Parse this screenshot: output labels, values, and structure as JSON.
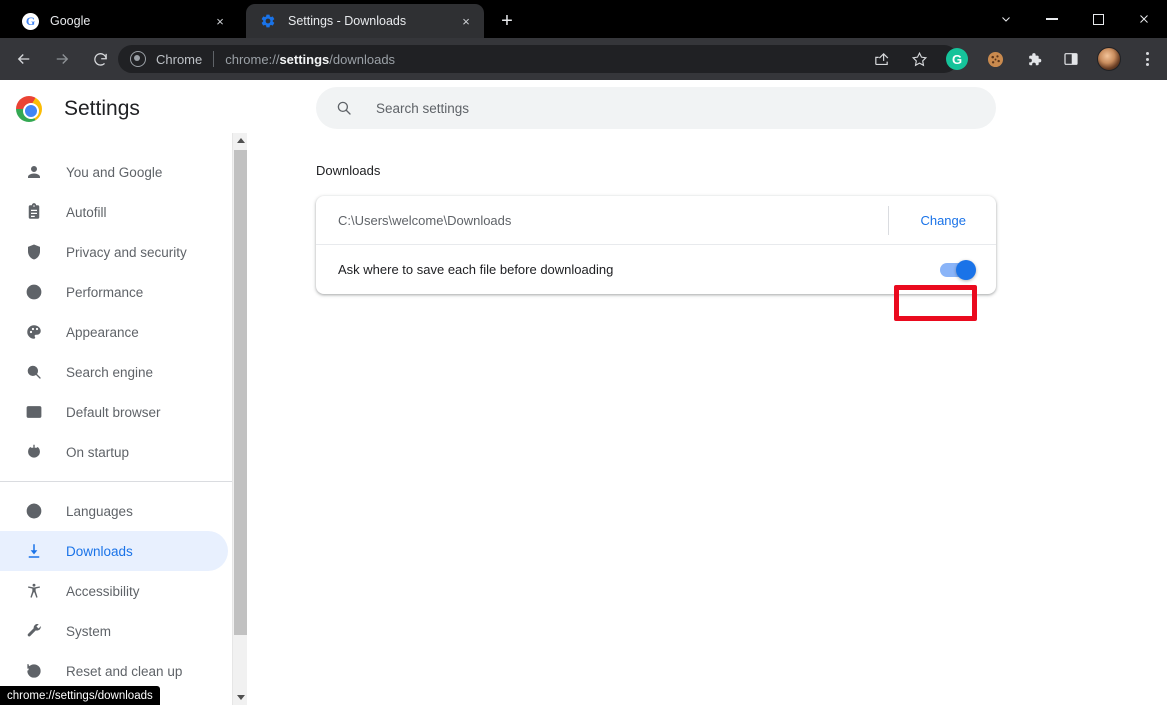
{
  "window": {
    "controls": [
      {
        "name": "tab-search",
        "glyph": "chevron-down"
      },
      {
        "name": "minimize",
        "glyph": "dash"
      },
      {
        "name": "maximize",
        "glyph": "square"
      },
      {
        "name": "close",
        "glyph": "×"
      }
    ]
  },
  "tabs": [
    {
      "title": "Google",
      "favicon": "google-g-icon",
      "active": false,
      "close_label": "×"
    },
    {
      "title": "Settings - Downloads",
      "favicon": "gear-icon",
      "active": true,
      "close_label": "×"
    }
  ],
  "newtab_label": "+",
  "toolbar": {
    "back_label": "←",
    "forward_label": "→",
    "reload_label": "⟳",
    "omnibox": {
      "site_label": "Chrome",
      "url_prefix": "chrome://",
      "url_bold": "settings",
      "url_suffix": "/downloads",
      "full_url": "chrome://settings/downloads"
    },
    "right_icons": [
      {
        "name": "share-icon"
      },
      {
        "name": "bookmark-star-icon"
      },
      {
        "name": "grammarly-extension-icon",
        "letter": "G",
        "color": "#15c39a"
      },
      {
        "name": "cookie-extension-icon",
        "color": "#b3733a"
      },
      {
        "name": "extensions-puzzle-icon"
      },
      {
        "name": "side-panel-icon"
      },
      {
        "name": "profile-avatar"
      },
      {
        "name": "chrome-menu-icon"
      }
    ]
  },
  "sidebar": {
    "title": "Settings",
    "logo": "chrome-logo-icon",
    "items": [
      {
        "label": "You and Google",
        "icon": "person-icon",
        "selected": false
      },
      {
        "label": "Autofill",
        "icon": "clipboard-icon",
        "selected": false
      },
      {
        "label": "Privacy and security",
        "icon": "shield-icon",
        "selected": false
      },
      {
        "label": "Performance",
        "icon": "speedometer-icon",
        "selected": false
      },
      {
        "label": "Appearance",
        "icon": "palette-icon",
        "selected": false
      },
      {
        "label": "Search engine",
        "icon": "search-icon",
        "selected": false
      },
      {
        "label": "Default browser",
        "icon": "browser-window-icon",
        "selected": false
      },
      {
        "label": "On startup",
        "icon": "power-icon",
        "selected": false
      },
      {
        "label": "Languages",
        "icon": "globe-icon",
        "selected": false
      },
      {
        "label": "Downloads",
        "icon": "download-icon",
        "selected": true
      },
      {
        "label": "Accessibility",
        "icon": "accessibility-icon",
        "selected": false
      },
      {
        "label": "System",
        "icon": "wrench-icon",
        "selected": false
      },
      {
        "label": "Reset and clean up",
        "icon": "restore-clock-icon",
        "selected": false
      }
    ]
  },
  "main": {
    "search": {
      "placeholder": "Search settings",
      "value": "",
      "icon": "search-icon"
    },
    "section_title": "Downloads",
    "location_row": {
      "path": "C:\\Users\\welcome\\Downloads",
      "change_label": "Change"
    },
    "ask_row": {
      "label": "Ask where to save each file before downloading",
      "toggle_on": true
    }
  },
  "status_bar": {
    "text": "chrome://settings/downloads"
  },
  "colors": {
    "accent_blue": "#1a73e8",
    "selected_pill": "#e8f0fe",
    "toggle_track": "#8ab4f8",
    "annotation_red": "#ea0a1e",
    "tabstrip_bg": "#000000",
    "toolbar_bg": "#35363a",
    "active_tab_bg": "#2f3033"
  }
}
